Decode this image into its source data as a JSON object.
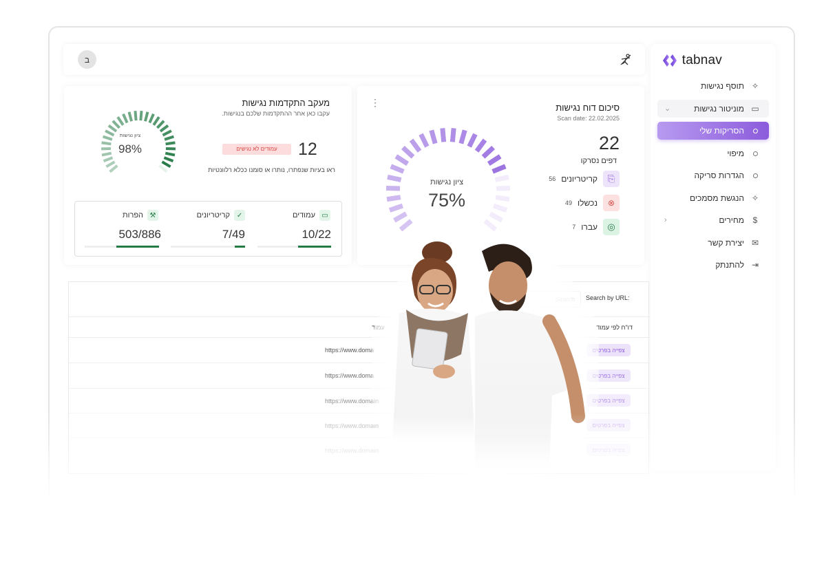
{
  "brand": {
    "name": "tabnav",
    "accent": "#8c5cdc"
  },
  "sidebar": {
    "items": [
      {
        "label": "תוסף נגישות",
        "icon": "sparkle-icon"
      },
      {
        "label": "מוניטור נגישות",
        "icon": "monitor-icon"
      },
      {
        "label": "הסריקות שלי",
        "icon": "circle-icon"
      },
      {
        "label": "מיפוי",
        "icon": "circle-icon"
      },
      {
        "label": "הגדרות סריקה",
        "icon": "circle-icon"
      },
      {
        "label": "הנגשת מסמכים",
        "icon": "sparkle-icon"
      },
      {
        "label": "מחירים",
        "icon": "dollar-icon"
      },
      {
        "label": "יצירת קשר",
        "icon": "mail-icon"
      },
      {
        "label": "להתנתק",
        "icon": "logout-icon"
      }
    ]
  },
  "header": {
    "avatar_letter": "ב"
  },
  "progress_card": {
    "title": "מעקב התקדמות נגישות",
    "subtitle": "עקבו כאן אחר ההתקדמות שלכם בנגישות.",
    "gauge_label": "ציון נגישות",
    "gauge_value": "98%",
    "gauge_fraction": 0.98,
    "count": "12",
    "badge": "עמודים לא נגישים",
    "note": "ראו בעיות שנפתרו, נותרו או סומנו ככלא רלוונטיות",
    "stats": [
      {
        "label": "עמודים",
        "value": "10/22",
        "fraction": 0.45
      },
      {
        "label": "קריטריונים",
        "value": "7/49",
        "fraction": 0.14
      },
      {
        "label": "הפרות",
        "value": "503/886",
        "fraction": 0.57
      }
    ]
  },
  "summary_card": {
    "title": "סיכום דוח נגישות",
    "scan_date": "Scan date: 22.02.2025",
    "pages_count": "22",
    "pages_label": "דפים נסרקו",
    "gauge_label": "ציון נגישות",
    "gauge_value": "75%",
    "gauge_fraction": 0.75,
    "rows": [
      {
        "label": "קריטריונים",
        "value": "56"
      },
      {
        "label": "נכשלו",
        "value": "49"
      },
      {
        "label": "עברו",
        "value": "7"
      }
    ]
  },
  "table": {
    "search_label": "Search by URL:",
    "search_placeholder": "Search",
    "col_report": "דו\"ח לפי עמוד",
    "col_page": "עמוד",
    "view_label": "צפייה בפרטים",
    "rows": [
      "https://www.doma",
      "https://www.doma",
      "https://www.domain",
      "https://www.domain",
      "https://www.domain"
    ]
  }
}
